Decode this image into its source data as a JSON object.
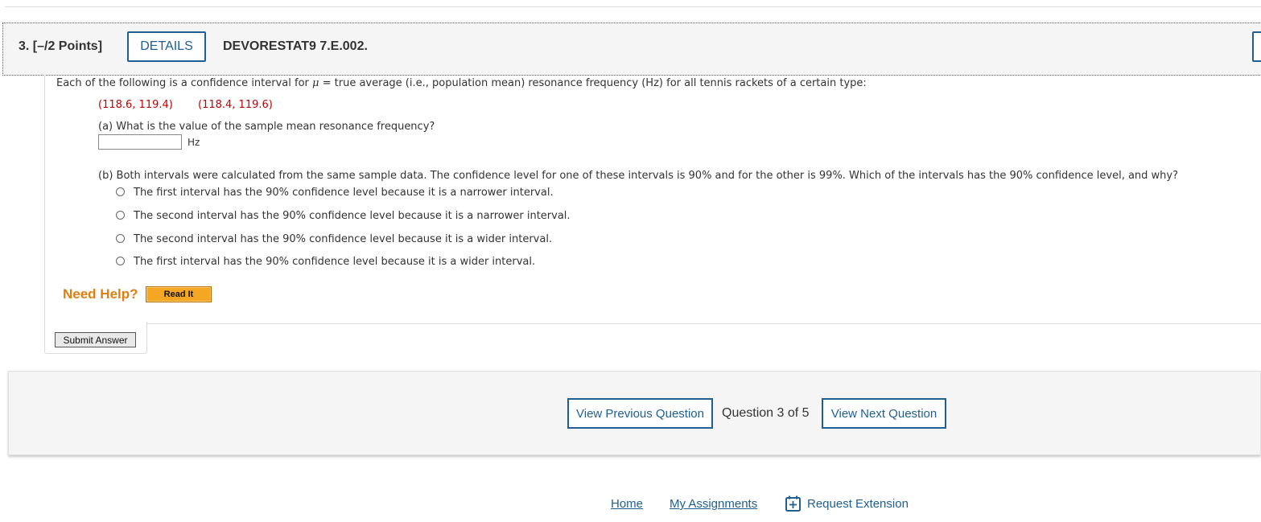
{
  "question": {
    "number_points": "3. [–/2 Points]",
    "details_label": "DETAILS",
    "code": "DEVORESTAT9 7.E.002."
  },
  "prompt": {
    "pre": "Each of the following is a confidence interval for ",
    "mu": "μ",
    "post": " = true average (i.e., population mean) resonance frequency (Hz) for all tennis rackets of a certain type:"
  },
  "intervals": [
    "(118.6, 119.4)",
    "(118.4, 119.6)"
  ],
  "part_a": {
    "question": "(a) What is the value of the sample mean resonance frequency?",
    "input_value": "",
    "unit": "Hz"
  },
  "part_b": {
    "question": "(b) Both intervals were calculated from the same sample data. The confidence level for one of these intervals is 90% and for the other is 99%. Which of the intervals has the 90% confidence level, and why?",
    "options": [
      "The first interval has the 90% confidence level because it is a narrower interval.",
      "The second interval has the 90% confidence level because it is a narrower interval.",
      "The second interval has the 90% confidence level because it is a wider interval.",
      "The first interval has the 90% confidence level because it is a wider interval."
    ]
  },
  "help": {
    "label": "Need Help?",
    "read_it": "Read It"
  },
  "submit": {
    "label": "Submit Answer"
  },
  "nav": {
    "prev": "View Previous Question",
    "counter": "Question 3 of 5",
    "next": "View Next Question"
  },
  "footer": {
    "home": "Home",
    "assignments": "My Assignments",
    "extension": "Request Extension"
  },
  "colors": {
    "accent": "#1f5f93",
    "help_orange": "#e07f10",
    "interval_red": "#c00000",
    "readit_bg": "#f5a623"
  }
}
